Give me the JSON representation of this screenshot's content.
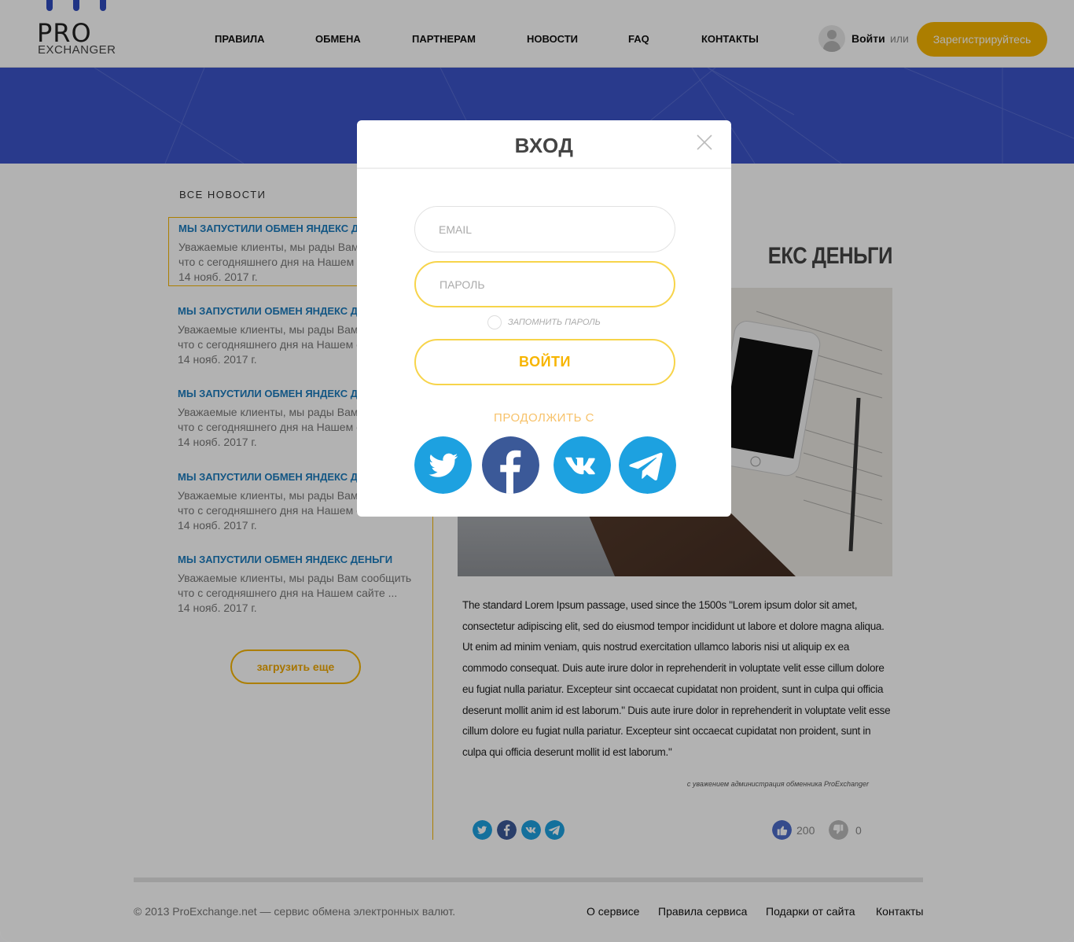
{
  "colors": {
    "accent": "#f7b500",
    "brand_blue": "#3b53c9",
    "link_blue": "#1c7bbd",
    "twitter": "#1da1e0",
    "facebook": "#3b5998",
    "vk": "#1da1e0",
    "telegram": "#1da1e0",
    "like": "#4c6cc9",
    "dislike": "#bbbbbb"
  },
  "header": {
    "logo_top": "PRO",
    "logo_bottom": "EXCHANGER",
    "nav": [
      "ПРАВИЛА",
      "ОБМЕНА",
      "ПАРТНЕРАМ",
      "НОВОСТИ",
      "FAQ",
      "КОНТАКТЫ"
    ],
    "login_label": "Войти",
    "or_label": "или",
    "register_label": "Зарегистрируйтесь",
    "user_icon": "user-icon"
  },
  "sidebar": {
    "heading": "ВСЕ НОВОСТИ",
    "items": [
      {
        "title": "МЫ ЗАПУСТИЛИ ОБМЕН ЯНДЕКС ДЕНЬГИ",
        "line1": "Уважаемые клиенты, мы рады Вам сообщить",
        "line2": "что с сегодняшнего дня на Нашем сайте ...",
        "date": "14 нояб. 2017 г."
      },
      {
        "title": "МЫ ЗАПУСТИЛИ ОБМЕН ЯНДЕКС ДЕНЬГИ",
        "line1": "Уважаемые клиенты, мы рады Вам сообщить",
        "line2": "что с сегодняшнего дня на Нашем сайте ...",
        "date": "14 нояб. 2017 г."
      },
      {
        "title": "МЫ ЗАПУСТИЛИ ОБМЕН ЯНДЕКС ДЕНЬГИ",
        "line1": "Уважаемые клиенты, мы рады Вам сообщить",
        "line2": "что с сегодняшнего дня на Нашем сайте ...",
        "date": "14 нояб. 2017 г."
      },
      {
        "title": "МЫ ЗАПУСТИЛИ ОБМЕН ЯНДЕКС ДЕНЬГИ",
        "line1": "Уважаемые клиенты, мы рады Вам сообщить",
        "line2": "что с сегодняшнего дня на Нашем сайте ...",
        "date": "14 нояб. 2017 г."
      },
      {
        "title": "МЫ ЗАПУСТИЛИ ОБМЕН ЯНДЕКС ДЕНЬГИ",
        "line1": "Уважаемые клиенты, мы рады Вам сообщить",
        "line2": "что с сегодняшнего дня на Нашем сайте ...",
        "date": "14 нояб. 2017 г."
      }
    ],
    "load_more": "загрузить еще"
  },
  "article": {
    "title_visible": "ЕКС ДЕНЬГИ",
    "body": "The standard Lorem Ipsum passage, used since the 1500s \"Lorem ipsum dolor sit amet, consectetur adipiscing elit, sed do eiusmod tempor incididunt ut labore et dolore magna aliqua. Ut enim ad minim veniam, quis nostrud exercitation ullamco laboris nisi ut aliquip ex ea commodo consequat. Duis aute irure dolor in reprehenderit in voluptate velit esse cillum dolore eu fugiat nulla pariatur. Excepteur sint occaecat cupidatat non proident, sunt in culpa qui officia deserunt mollit anim id est laborum.\" Duis aute irure dolor in reprehenderit in voluptate velit esse cillum dolore eu fugiat nulla pariatur. Excepteur sint occaecat cupidatat non proident, sunt in culpa qui officia deserunt mollit id est laborum.\"",
    "signature": "с уважением администрация обменника ProExchanger",
    "share_icons": [
      "twitter-icon",
      "facebook-icon",
      "vk-icon",
      "telegram-icon"
    ],
    "likes": "200",
    "dislikes": "0"
  },
  "footer": {
    "copyright": "© 2013 ProExchange.net — сервис обмена электронных валют.",
    "links": [
      "О сервисе",
      "Правила сервиса",
      "Подарки от сайта",
      "Контакты"
    ]
  },
  "modal": {
    "title": "ВХОД",
    "email_placeholder": "EMAIL",
    "password_placeholder": "ПАРОЛЬ",
    "remember_label": "ЗАПОМНИТЬ ПАРОЛЬ",
    "submit_label": "ВОЙТИ",
    "continue_label": "ПРОДОЛЖИТЬ С",
    "social": [
      "twitter-icon",
      "facebook-icon",
      "vk-icon",
      "telegram-icon"
    ]
  }
}
